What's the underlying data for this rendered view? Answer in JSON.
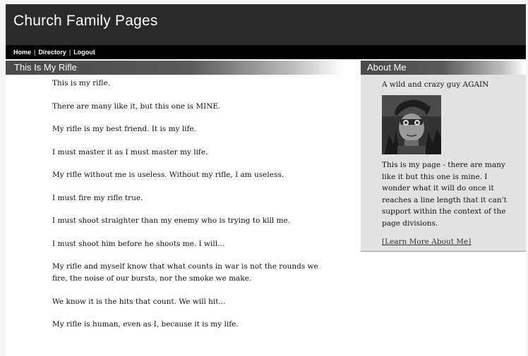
{
  "site": {
    "title": "Church Family Pages"
  },
  "nav": {
    "home": "Home",
    "directory": "Directory",
    "logout": "Logout",
    "separator": "|"
  },
  "main": {
    "title": "This Is My Rifle",
    "lines": [
      "This is my rifle.",
      "There are many like it, but this one is MINE.",
      "My rifle is my best friend. It is my life.",
      "I must master it as I must master my life.",
      "My rifle without me is useless. Without my rifle, I am useless.",
      "I must fire my rifle true.",
      "I must shoot straighter than my enemy who is trying to kill me.",
      "I must shoot him before he shoots me. I will...",
      "My rifle and myself know that what counts in war is not the rounds we fire, the noise of our bursts, nor the smoke we make.",
      "We know it is the hits that count. We will hit...",
      "My rifle is human, even as I, because it is my life."
    ]
  },
  "about": {
    "title": "About Me",
    "tagline": "A wild and crazy guy AGAIN",
    "bio": "This is my page - there are many like it but this one is mine. I wonder what it will do once it reaches a line length that it can't support within the context of the page divisions.",
    "link": "[Learn More About Me]"
  },
  "colors": {
    "header_bg": "#2a2a2a",
    "nav_bg": "#000000",
    "sidebar_bg": "#e2e2e2"
  }
}
